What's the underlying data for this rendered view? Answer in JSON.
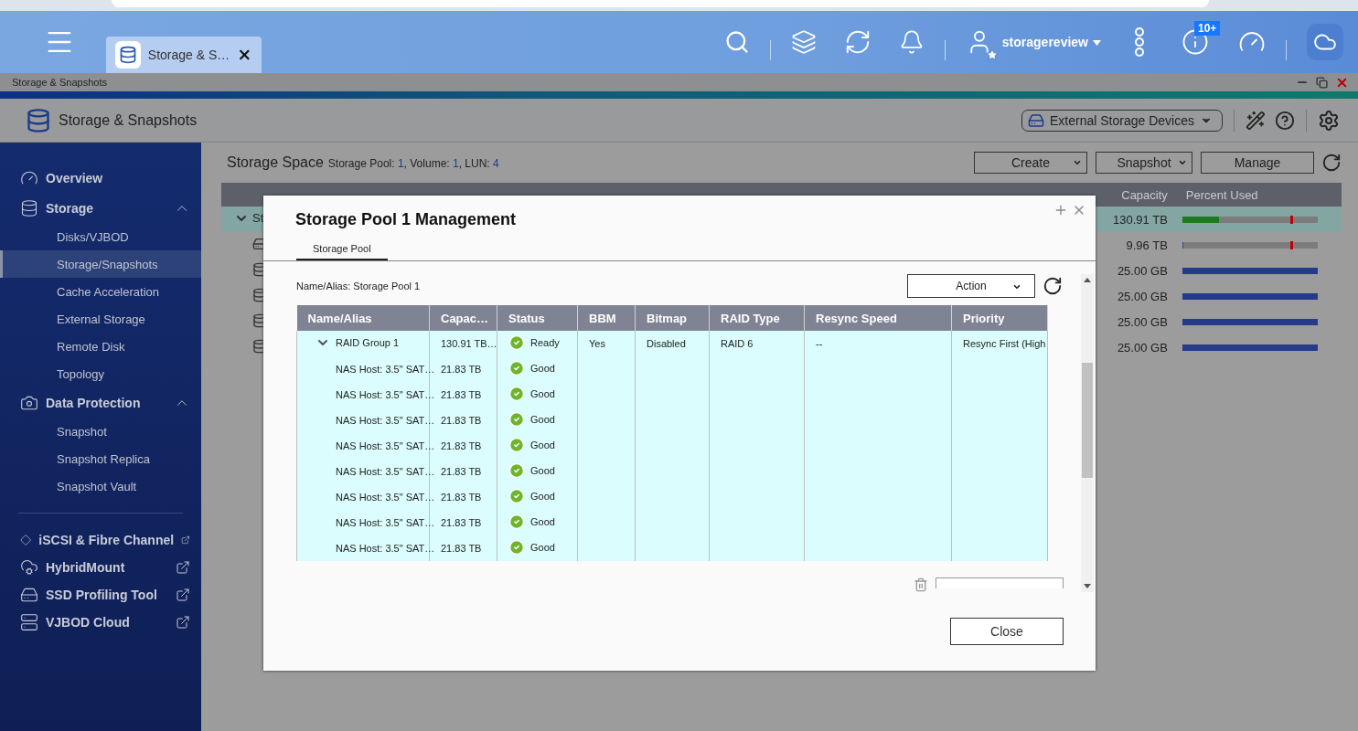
{
  "top_bar": {
    "tab": {
      "label": "Storage & S…"
    },
    "user": "storagereview",
    "notification_badge": "10+"
  },
  "window": {
    "title": "Storage & Snapshots"
  },
  "app_header": {
    "title": "Storage & Snapshots",
    "device_menu": "External Storage Devices"
  },
  "sidebar": {
    "items": [
      {
        "label": "Overview",
        "kind": "overview"
      },
      {
        "label": "Storage",
        "kind": "storage",
        "expanded": true,
        "children": [
          {
            "label": "Disks/VJBOD",
            "selected": false
          },
          {
            "label": "Storage/Snapshots",
            "selected": true
          },
          {
            "label": "Cache Acceleration",
            "selected": false
          },
          {
            "label": "External Storage",
            "selected": false
          },
          {
            "label": "Remote Disk",
            "selected": false
          },
          {
            "label": "Topology",
            "selected": false
          }
        ]
      },
      {
        "label": "Data Protection",
        "kind": "protection",
        "expanded": true,
        "children": [
          {
            "label": "Snapshot",
            "selected": false
          },
          {
            "label": "Snapshot Replica",
            "selected": false
          },
          {
            "label": "Snapshot Vault",
            "selected": false
          }
        ]
      },
      {
        "label": "iSCSI & Fibre Channel",
        "kind": "iscsi",
        "external": true
      },
      {
        "label": "HybridMount",
        "kind": "hybrid",
        "external": true
      },
      {
        "label": "SSD Profiling Tool",
        "kind": "ssd",
        "external": true
      },
      {
        "label": "VJBOD Cloud",
        "kind": "vjbod",
        "external": true
      }
    ]
  },
  "storage_space": {
    "title": "Storage Space",
    "summary": [
      {
        "label": "Storage Pool: ",
        "value": "1"
      },
      {
        "label": ", Volume: ",
        "value": "1"
      },
      {
        "label": ", LUN: ",
        "value": "4"
      }
    ],
    "buttons": [
      {
        "label": "Create",
        "kind": "dropdown"
      },
      {
        "label": "Snapshot",
        "kind": "dropdown"
      },
      {
        "label": "Manage",
        "kind": "plain"
      }
    ],
    "table": {
      "columns": [
        "Capacity",
        "Percent Used"
      ],
      "rows": [
        {
          "kind": "pool",
          "name": "St",
          "selected": true,
          "capacity": "130.91 TB",
          "level": 0.27,
          "color": "#1e7a1e",
          "alert_marker": true
        },
        {
          "kind": "volume",
          "selected": false,
          "capacity": "9.96 TB",
          "level": 0.01,
          "color": "#2a4aa0",
          "alert_marker": true
        },
        {
          "kind": "lun",
          "selected": false,
          "capacity": "25.00 GB",
          "level": 1,
          "color": "#263a8a",
          "alert_marker": false
        },
        {
          "kind": "lun",
          "selected": false,
          "capacity": "25.00 GB",
          "level": 1,
          "color": "#263a8a",
          "alert_marker": false
        },
        {
          "kind": "lun",
          "selected": false,
          "capacity": "25.00 GB",
          "level": 1,
          "color": "#263a8a",
          "alert_marker": false
        },
        {
          "kind": "lun",
          "selected": false,
          "capacity": "25.00 GB",
          "level": 1,
          "color": "#263a8a",
          "alert_marker": false
        }
      ]
    }
  },
  "dialog": {
    "title": "Storage Pool 1 Management",
    "tabs": [
      {
        "label": "Storage Pool",
        "selected": true
      }
    ],
    "name_alias": "Name/Alias: Storage Pool 1",
    "action_menu": "Action",
    "table": {
      "columns": [
        "Name/Alias",
        "Capac…",
        "Status",
        "BBM",
        "Bitmap",
        "RAID Type",
        "Resync Speed",
        "Priority"
      ],
      "groups": [
        {
          "name": "RAID Group 1",
          "expanded": true,
          "capacity": "130.91 TB…",
          "status": "Ready",
          "bbm": "Yes",
          "bitmap": "Disabled",
          "raid_type": "RAID 6",
          "resync_speed": "--",
          "priority": "Resync First (High",
          "children": [
            {
              "name": "NAS Host: 3.5\" SAT…",
              "capacity": "21.83 TB",
              "status": "Good"
            },
            {
              "name": "NAS Host: 3.5\" SAT…",
              "capacity": "21.83 TB",
              "status": "Good"
            },
            {
              "name": "NAS Host: 3.5\" SAT…",
              "capacity": "21.83 TB",
              "status": "Good"
            },
            {
              "name": "NAS Host: 3.5\" SAT…",
              "capacity": "21.83 TB",
              "status": "Good"
            },
            {
              "name": "NAS Host: 3.5\" SAT…",
              "capacity": "21.83 TB",
              "status": "Good"
            },
            {
              "name": "NAS Host: 3.5\" SAT…",
              "capacity": "21.83 TB",
              "status": "Good"
            },
            {
              "name": "NAS Host: 3.5\" SAT…",
              "capacity": "21.83 TB",
              "status": "Good"
            },
            {
              "name": "NAS Host: 3.5\" SAT…",
              "capacity": "21.83 TB",
              "status": "Good"
            }
          ]
        }
      ]
    },
    "close_button": "Close"
  }
}
